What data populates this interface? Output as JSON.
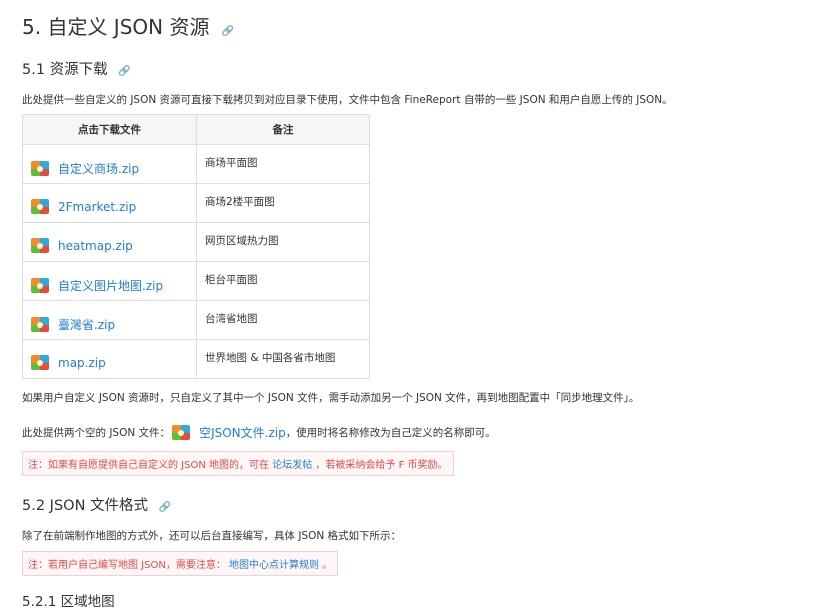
{
  "section": {
    "title": "5. 自定义 JSON 资源",
    "link_icon": "link-icon"
  },
  "sub1": {
    "title": "5.1 资源下载",
    "intro": "此处提供一些自定义的 JSON 资源可直接下载拷贝到对应目录下使用，文件中包含 FineReport 自带的一些 JSON 和用户自愿上传的 JSON。",
    "table": {
      "headers": [
        "点击下载文件",
        "备注"
      ],
      "rows": [
        {
          "file": "自定义商场.zip",
          "note": "商场平面图"
        },
        {
          "file": "2Fmarket.zip",
          "note": "商场2楼平面图"
        },
        {
          "file": "heatmap.zip",
          "note": "网页区域热力图"
        },
        {
          "file": "自定义图片地图.zip",
          "note": "柜台平面图"
        },
        {
          "file": "臺灣省.zip",
          "note": "台湾省地图"
        },
        {
          "file": "map.zip",
          "note": "世界地图 & 中国各省市地图"
        }
      ]
    },
    "para2": "如果用户自定义 JSON 资源时，只自定义了其中一个 JSON 文件，需手动添加另一个 JSON 文件，再到地图配置中「同步地理文件」。",
    "para3_prefix": "此处提供两个空的 JSON 文件：",
    "para3_link": "空JSON文件.zip",
    "para3_suffix": "，使用时将名称修改为自己定义的名称即可。",
    "notice_prefix": "注：如果有自愿提供自己自定义的 JSON 地图的，可在",
    "notice_link": "论坛发帖",
    "notice_suffix": "，若被采纳会给予 F 币奖励。"
  },
  "sub2": {
    "title": "5.2 JSON 文件格式",
    "intro": "除了在前端制作地图的方式外，还可以后台直接编写，具体 JSON 格式如下所示：",
    "notice_prefix": "注：若用户自己编写地图 JSON，需要注意：",
    "notice_link": "地图中心点计算规则",
    "notice_suffix": "。"
  },
  "sub3": {
    "title": "5.2.1 区域地图"
  },
  "colors": {
    "link": "#1f7ed0",
    "notice_text": "#e04848",
    "notice_bg": "#fff7f7"
  }
}
